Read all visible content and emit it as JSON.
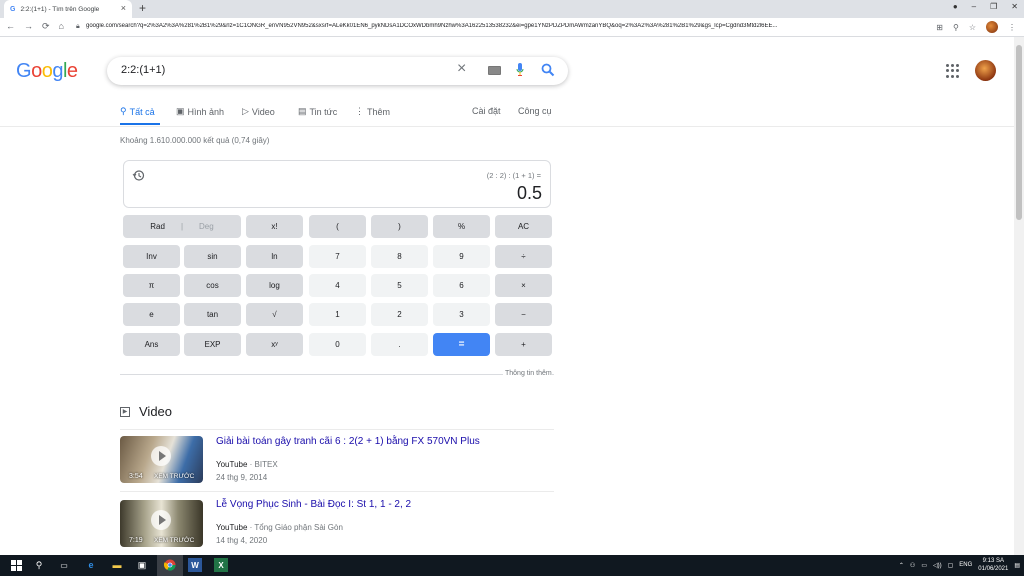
{
  "browser": {
    "tab_title": "2:2:(1+1) - Tìm trên Google",
    "tab_favicon": "G",
    "new_tab": "+",
    "url": "google.com/search?q=2%3A2%3A%281%2B1%29&rlz=1C1ONGR_enVN952VN952&sxsrf=ALeKk01EN6_pykNDsA1DCOxWDbmh9Nzhw%3A1622513538232&ei=gpe1YNzPDZPDmAWmzanYBQ&oq=2%3A2%3A%281%2B1%29&gs_lcp=Cgdnd3Mtd2l6EE..."
  },
  "search": {
    "query": "2:2:(1+1)"
  },
  "tabs": {
    "all": "Tất cả",
    "images": "Hình ảnh",
    "video": "Video",
    "news": "Tin tức",
    "more": "Thêm",
    "settings": "Cài đặt",
    "tools": "Công cụ"
  },
  "stats": "Khoảng 1.610.000.000 kết quả (0,74 giây)",
  "calculator": {
    "expression": "(2 : 2) : (1 + 1) =",
    "result": "0.5",
    "keys": {
      "rad": "Rad",
      "deg": "Deg",
      "fact": "x!",
      "lparen": "(",
      "rparen": ")",
      "percent": "%",
      "ac": "AC",
      "inv": "Inv",
      "sin": "sin",
      "ln": "ln",
      "k7": "7",
      "k8": "8",
      "k9": "9",
      "div": "÷",
      "pi": "π",
      "cos": "cos",
      "log": "log",
      "k4": "4",
      "k5": "5",
      "k6": "6",
      "mul": "×",
      "e": "e",
      "tan": "tan",
      "sqrt": "√",
      "k1": "1",
      "k2": "2",
      "k3": "3",
      "minus": "−",
      "ans": "Ans",
      "exp": "EXP",
      "pow": "xʸ",
      "k0": "0",
      "dot": ".",
      "eq": "=",
      "plus": "+"
    },
    "more_info": "Thông tin thêm"
  },
  "videos": {
    "heading": "Video",
    "items": [
      {
        "title": "Giải bài toán gây tranh cãi 6 : 2(2 + 1) bằng FX 570VN Plus",
        "source": "YouTube",
        "channel": "BITEX",
        "date": "24 thg 9, 2014",
        "duration": "3:54",
        "preview": "XEM TRƯỚC"
      },
      {
        "title": "Lễ Vọng Phục Sinh - Bài Đọc I: St 1, 1 - 2, 2",
        "source": "YouTube",
        "channel": "Tổng Giáo phận Sài Gòn",
        "date": "14 thg 4, 2020",
        "duration": "7:19",
        "preview": "XEM TRƯỚC"
      }
    ]
  },
  "taskbar": {
    "lang": "ENG",
    "time": "9:13 SA",
    "date": "01/06/2021"
  }
}
